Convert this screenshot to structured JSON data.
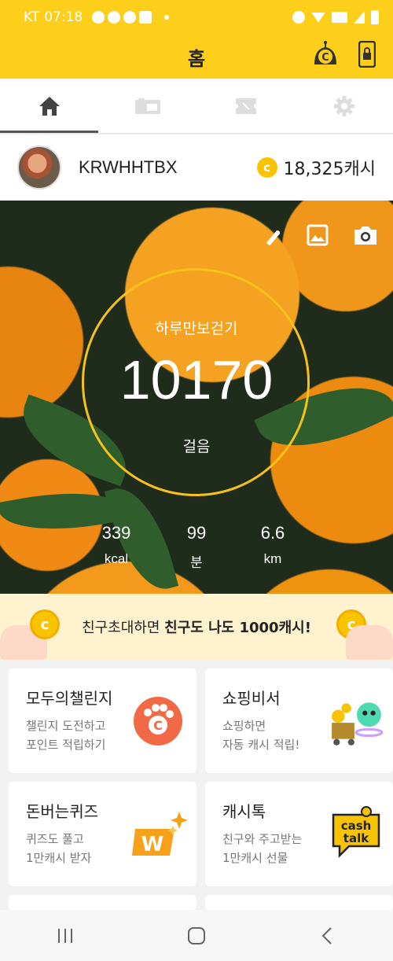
{
  "status_bar": {
    "carrier": "KT",
    "time": "07:18"
  },
  "header": {
    "title": "홈"
  },
  "tabs": [
    {
      "name": "home",
      "icon": "home-icon",
      "active": true
    },
    {
      "name": "coupon",
      "icon": "coupon-icon",
      "active": false
    },
    {
      "name": "ticket",
      "icon": "ticket-icon",
      "active": false
    },
    {
      "name": "settings",
      "icon": "gear-icon",
      "active": false
    }
  ],
  "profile": {
    "username": "KRWHHTBX",
    "cash": "18,325캐시"
  },
  "pedometer": {
    "label": "하루만보걷기",
    "steps": "10170",
    "steps_unit": "걸음",
    "stats": [
      {
        "value": "339",
        "unit": "kcal"
      },
      {
        "value": "99",
        "unit": "분"
      },
      {
        "value": "6.6",
        "unit": "km"
      }
    ]
  },
  "banner": {
    "text_plain": "친구초대하면 ",
    "text_bold": "친구도 나도 1000캐시!"
  },
  "cards": [
    {
      "title": "모두의챌린지",
      "line1": "챌린지 도전하고",
      "line2": "포인트 적립하기"
    },
    {
      "title": "쇼핑비서",
      "line1": "쇼핑하면",
      "line2": "자동 캐시 적립!"
    },
    {
      "title": "돈버는퀴즈",
      "line1": "퀴즈도 풀고",
      "line2": "1만캐시 받자"
    },
    {
      "title": "캐시톡",
      "line1": "친구와 주고받는",
      "line2": "1만캐시 선물",
      "logo_text": [
        "cash",
        "talk"
      ]
    }
  ],
  "colors": {
    "brand": "#fdcf1a",
    "ring": "#f6c21a",
    "coin": "#f8c400",
    "challenge": "#f26a45"
  }
}
